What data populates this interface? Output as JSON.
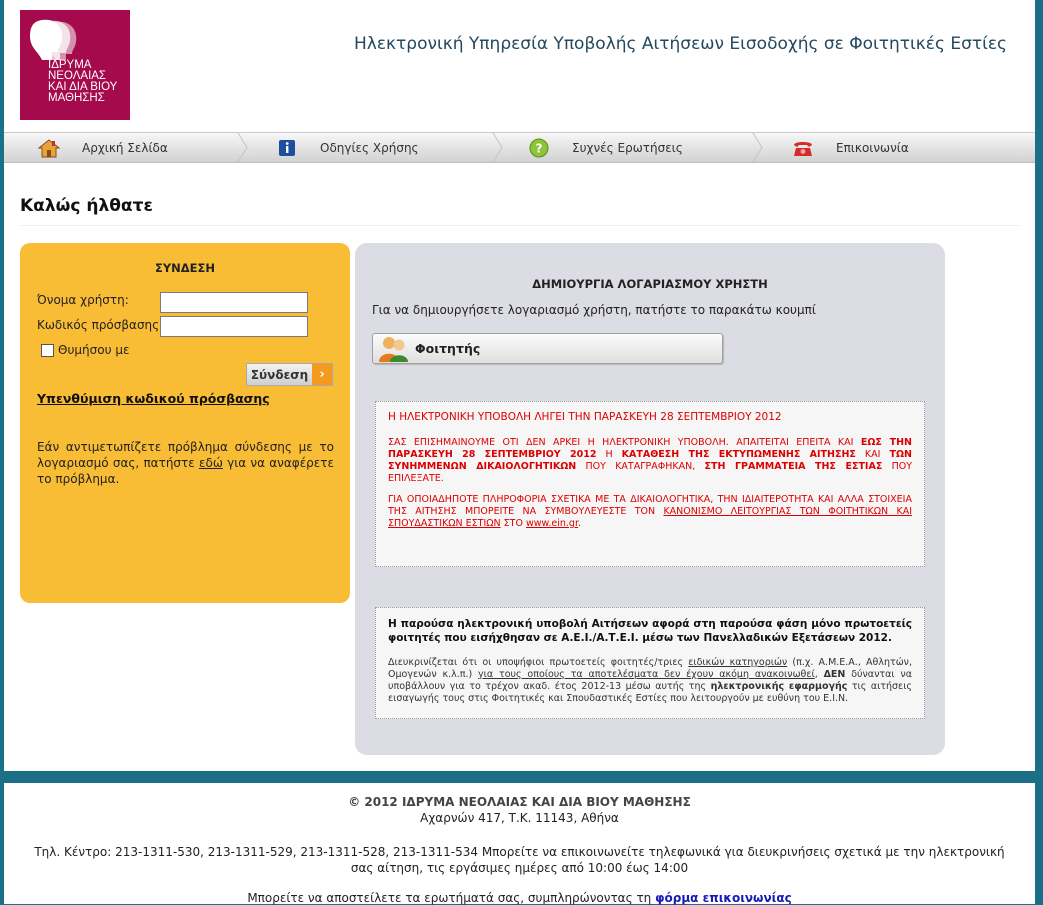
{
  "header": {
    "logo_text": "ΙΔΡΥΜΑ\nΝΕΟΛΑΙΑΣ\nΚΑΙ ΔΙΑ ΒΙΟΥ\nΜΑΘΗΣΗΣ",
    "logo_color": "#a50a4c",
    "site_title": "Ηλεκτρονική Υπηρεσία Υποβολής Αιτήσεων Εισοδοχής σε Φοιτητικές Εστίες"
  },
  "nav": {
    "items": [
      {
        "label": "Αρχική Σελίδα",
        "icon": "home-icon"
      },
      {
        "label": "Οδηγίες Χρήσης",
        "icon": "info-icon"
      },
      {
        "label": "Συχνές Ερωτήσεις",
        "icon": "help-icon"
      },
      {
        "label": "Επικοινωνία",
        "icon": "phone-icon"
      }
    ]
  },
  "welcome": "Καλώς ήλθατε",
  "login": {
    "title": "ΣΥΝΔΕΣΗ",
    "username_label": "Όνομα χρήστη:",
    "username_value": "",
    "password_label": "Κωδικός πρόσβασης:",
    "password_value": "",
    "remember_label": "Θυμήσου με",
    "remember_checked": false,
    "submit_label": "Σύνδεση",
    "forgot_label": "Υπενθύμιση κωδικού πρόσβασης",
    "problem_text_1": "Εάν αντιμετωπίζετε πρόβλημα σύνδεσης με το λογαριασμό σας, πατήστε ",
    "problem_link": "εδώ",
    "problem_text_2": " για να αναφέρετε το πρόβλημα.",
    "panel_color": "#f9bc35"
  },
  "account": {
    "title": "ΔΗΜΙΟΥΡΓΙΑ ΛΟΓΑΡΙΑΣΜΟΥ ΧΡΗΣΤΗ",
    "description": "Για να δημιουργήσετε λογαριασμό χρήστη, πατήστε το παρακάτω κουμπί",
    "student_button": "Φοιτητής",
    "notice1": {
      "heading": "Η ΗΛΕΚΤΡΟΝΙΚΗ ΥΠΟΒΟΛΗ ΛΗΓΕΙ ΤΗΝ ΠΑΡΑΣΚΕΥΗ 28 ΣΕΠΤΕΜΒΡΙΟΥ 2012",
      "p1_a": "ΣΑΣ ΕΠΙΣΗΜΑΙΝΟΥΜΕ ΟΤΙ ΔΕΝ ΑΡΚΕΙ Η ΗΛΕΚΤΡΟΝΙΚΗ ΥΠΟΒΟΛΗ. ΑΠΑΙΤΕΙΤΑΙ ΕΠΕΙΤΑ ΚΑΙ ",
      "p1_b": "ΕΩΣ ΤΗΝ ΠΑΡΑΣΚΕΥΗ 28 ΣΕΠΤΕΜΒΡΙΟΥ 2012",
      "p1_c": " Η ",
      "p1_d": "ΚΑΤΑΘΕΣΗ ΤΗΣ ΕΚΤΥΠΩΜΕΝΗΣ ΑΙΤΗΣΗΣ",
      "p1_e": " ΚΑΙ ",
      "p1_f": "ΤΩΝ ΣΥΝΗΜΜΕΝΩΝ ΔΙΚΑΙΟΛΟΓΗΤΙΚΩΝ",
      "p1_g": " ΠΟΥ ΚΑΤΑΓΡΑΦΗΚΑΝ, ",
      "p1_h": "ΣΤΗ ΓΡΑΜΜΑΤΕΙΑ ΤΗΣ ΕΣΤΙΑΣ",
      "p1_i": " ΠΟΥ ΕΠΙΛΕΞΑΤΕ.",
      "p2_a": "ΓΙΑ ΟΠΟΙΑΔΗΠΟΤΕ ΠΛΗΡΟΦΟΡΙΑ ΣΧΕΤΙΚΑ ΜΕ ΤΑ ΔΙΚΑΙΟΛΟΓΗΤΙΚΑ, ΤΗΝ ΙΔΙΑΙΤΕΡΟΤΗΤΑ ΚΑΙ ΑΛΛΑ ΣΤΟΙΧΕΙΑ ΤΗΣ ΑΙΤΗΣΗΣ ΜΠΟΡΕΙΤΕ ΝΑ ΣΥΜΒΟΥΛΕΥΕΣΤΕ ΤΟΝ ",
      "p2_link": "ΚΑΝΟΝΙΣΜΟ ΛΕΙΤΟΥΡΓΙΑΣ ΤΩΝ ΦΟΙΤΗΤΙΚΩΝ ΚΑΙ ΣΠΟΥΔΑΣΤΙΚΩΝ ΕΣΤΙΩΝ",
      "p2_b": " ΣΤΟ ",
      "p2_site": "www.ein.gr",
      "p2_c": "."
    },
    "notice2": {
      "heading": "Η παρούσα ηλεκτρονική υποβολή Αιτήσεων αφορά στη παρούσα φάση μόνο πρωτοετείς φοιτητές που εισήχθησαν σε Α.Ε.Ι./Α.Τ.Ε.Ι. μέσω των Πανελλαδικών Εξετάσεων 2012.",
      "t1": "Διευκρινίζεται ότι οι υποψήφιοι πρωτοετείς φοιτητές/τριες ",
      "link1": "ειδικών κατηγοριών",
      "t2": " (π.χ. Α.Μ.Ε.Α., Αθλητών, Ομογενών κ.λ.π.) ",
      "link2": "για τους οποίους τα αποτελέσματα δεν έχουν ακόμη ανακοινωθεί",
      "t3": ", ",
      "bold1": "ΔΕΝ",
      "t4": " δύνανται να υποβάλλουν για το τρέχον ακαδ. έτος 2012-13 μέσω αυτής της ",
      "bold2": "ηλεκτρονικής εφαρμογής",
      "t5": " τις αιτήσεις εισαγωγής τους στις Φοιτητικές και Σπουδαστικές Εστίες που λειτουργούν με ευθύνη του Ε.Ι.Ν."
    }
  },
  "footer": {
    "copyright": "© 2012 ΙΔΡΥΜΑ ΝΕΟΛΑΙΑΣ ΚΑΙ ΔΙΑ ΒΙΟΥ ΜΑΘΗΣΗΣ",
    "address": "Αχαρνών 417, Τ.Κ. 11143, Αθήνα",
    "phones": "Τηλ. Κέντρο: 213-1311-530, 213-1311-529, 213-1311-528, 213-1311-534 Μπορείτε να επικοινωνείτε τηλεφωνικά για διευκρινήσεις σχετικά με την ηλεκτρονική σας αίτηση, τις εργάσιμες ημέρες από 10:00 έως 14:00",
    "contact_text": "Μπορείτε να αποστείλετε τα ερωτήματά σας, συμπληρώνοντας τη ",
    "contact_link": "φόρμα επικοινωνίας"
  },
  "colors": {
    "background": "#1b6f86",
    "account_panel": "#dcdce5",
    "notice_red": "#dd0000",
    "link_blue": "#1a1ab8"
  }
}
